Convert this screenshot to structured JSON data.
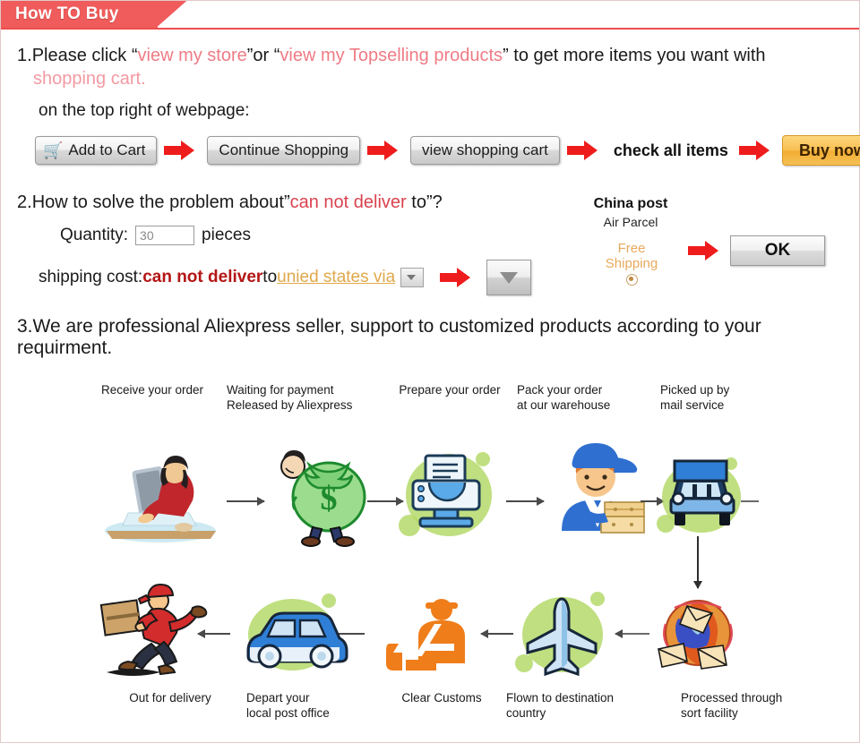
{
  "header": {
    "title": "How TO Buy",
    "accent_color": "#f05b5b"
  },
  "step1": {
    "number": "1.",
    "text_a": "Please click “",
    "link_store": "view my store",
    "text_b": "”or “",
    "link_topselling": "view my Topselling products",
    "text_c": "” to get more items you want with ",
    "text_d": "shopping cart.",
    "subtext": "on the top right of webpage:",
    "buttons": {
      "add_to_cart": "Add to Cart",
      "cart_icon": "cart-icon",
      "continue_shopping": "Continue Shopping",
      "view_shopping_cart": "view shopping cart",
      "check_all_items": "check all items",
      "buy_now": "Buy now",
      "buy_now_color": "#f2ad33"
    }
  },
  "step2": {
    "number": "2.",
    "title_a": "How to solve the problem about”",
    "title_red": "can not deliver",
    "title_b": " to”?",
    "quantity_label": "Quantity:",
    "quantity_value": "30",
    "quantity_unit": "pieces",
    "shipping_label": "shipping cost:",
    "shipping_red": "can not deliver",
    "shipping_to": " to ",
    "country_link": "unied states via",
    "carrier_title": "China post",
    "carrier_sub": "Air Parcel",
    "free_shipping_line1": "Free",
    "free_shipping_line2": "Shipping",
    "free_shipping_color": "#e8a95c",
    "ok_button": "OK"
  },
  "step3": {
    "number": "3.",
    "title": "We are professional Aliexpress seller, support to customized products according to your requirment.",
    "flow_top": [
      {
        "label": "Receive your order",
        "icon": "person-at-computer-icon"
      },
      {
        "label": "Waiting for payment\nReleased by Aliexpress",
        "icon": "money-bag-icon"
      },
      {
        "label": "Prepare your order",
        "icon": "printer-icon"
      },
      {
        "label": "Pack your order\nat our warehouse",
        "icon": "worker-with-boxes-icon"
      },
      {
        "label": "Picked up by\nmail service",
        "icon": "truck-icon"
      }
    ],
    "flow_bottom": [
      {
        "label": "Out for delivery",
        "icon": "running-courier-icon"
      },
      {
        "label": "Depart your\nlocal post office",
        "icon": "van-icon"
      },
      {
        "label": "Clear Customs",
        "icon": "customs-officer-icon"
      },
      {
        "label": "Flown to destination\ncountry",
        "icon": "airplane-icon"
      },
      {
        "label": "Processed through\nsort facility",
        "icon": "globe-mail-icon"
      }
    ]
  }
}
